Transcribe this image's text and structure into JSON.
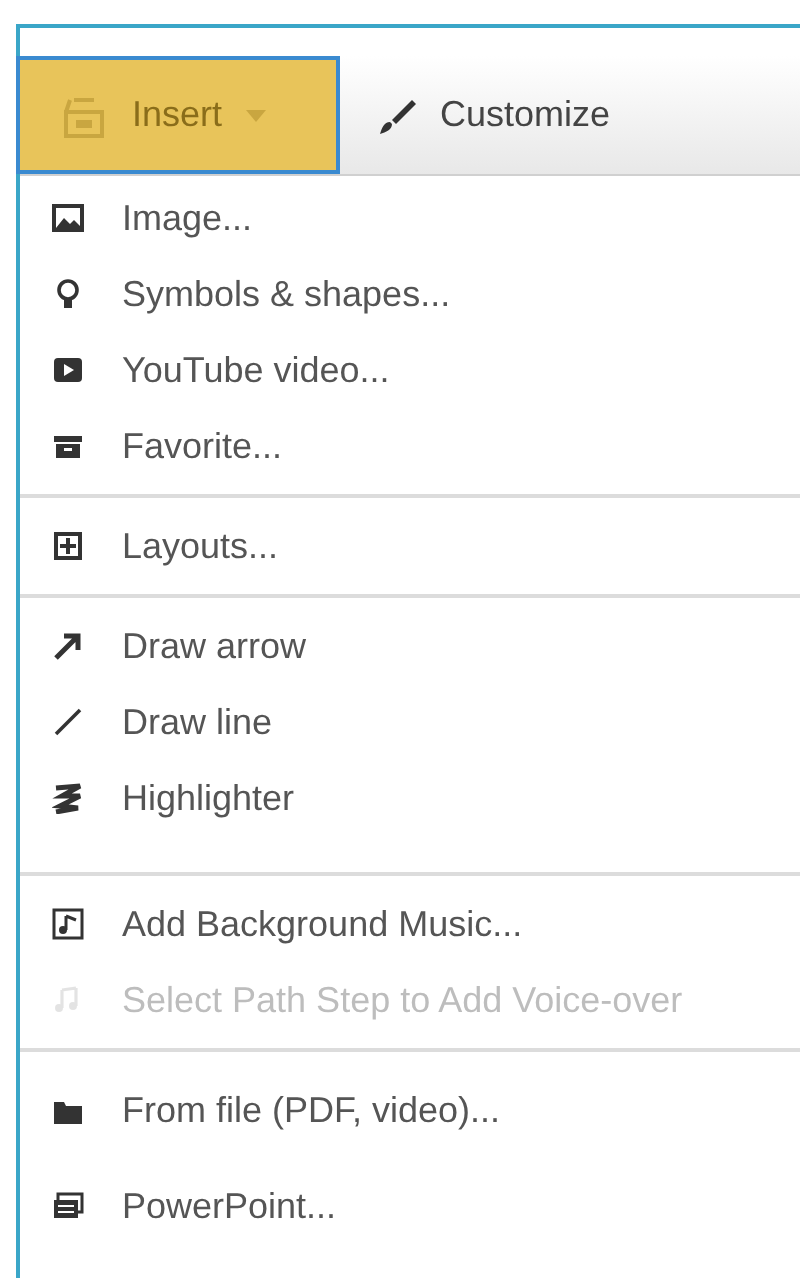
{
  "toolbar": {
    "buttons": [
      {
        "label": "Insert",
        "selected": true
      },
      {
        "label": "Customize",
        "selected": false
      }
    ]
  },
  "menu": {
    "sections": [
      [
        {
          "label": "Image...",
          "disabled": false
        },
        {
          "label": "Symbols & shapes...",
          "disabled": false
        },
        {
          "label": "YouTube video...",
          "disabled": false
        },
        {
          "label": "Favorite...",
          "disabled": false
        }
      ],
      [
        {
          "label": "Layouts...",
          "disabled": false
        }
      ],
      [
        {
          "label": "Draw arrow",
          "disabled": false
        },
        {
          "label": "Draw line",
          "disabled": false
        },
        {
          "label": "Highlighter",
          "disabled": false
        }
      ],
      [
        {
          "label": "Add Background Music...",
          "disabled": false
        },
        {
          "label": "Select Path Step to Add Voice-over",
          "disabled": true
        }
      ],
      [
        {
          "label": "From file (PDF, video)...",
          "disabled": false
        },
        {
          "label": "PowerPoint...",
          "disabled": false
        }
      ]
    ]
  }
}
